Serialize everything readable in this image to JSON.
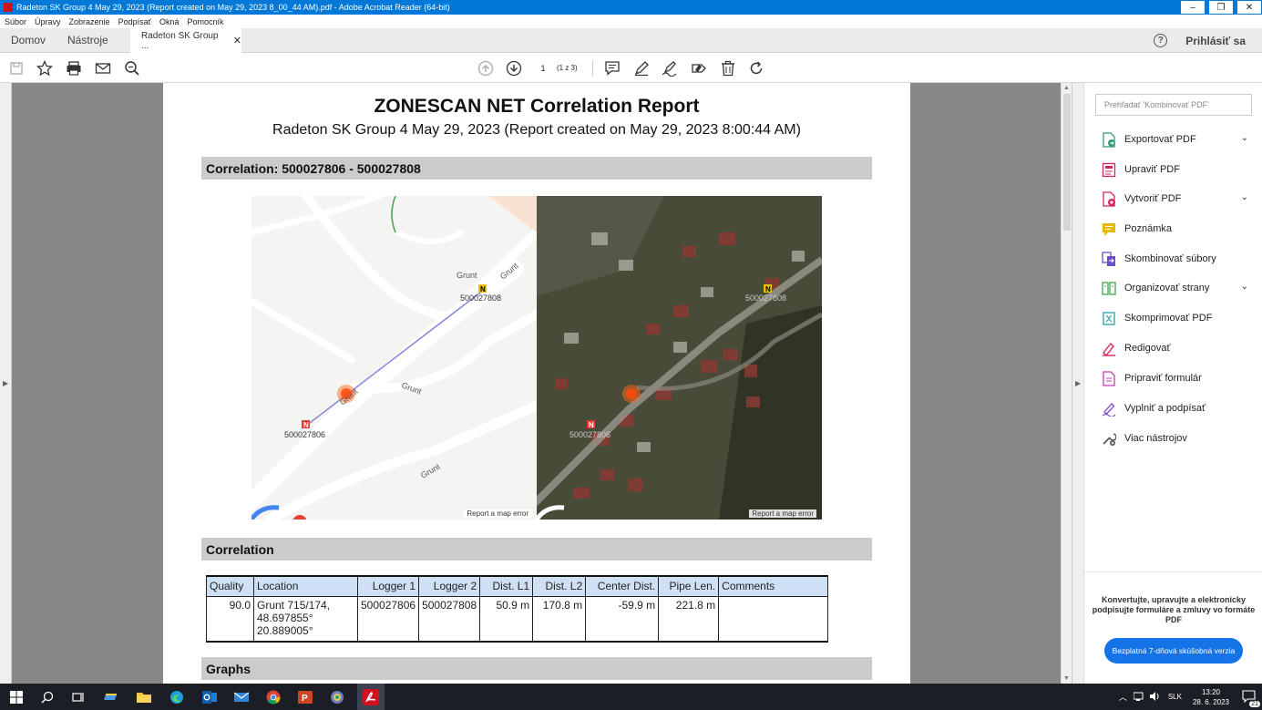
{
  "window": {
    "title": "Radeton SK Group 4 May 29, 2023 (Report created on May 29, 2023 8_00_44 AM).pdf - Adobe Acrobat Reader (64-bit)"
  },
  "menu": [
    "Súbor",
    "Úpravy",
    "Zobrazenie",
    "Podpísať",
    "Okná",
    "Pomocník"
  ],
  "tabs": {
    "home": "Domov",
    "tools": "Nástroje",
    "document": "Radeton SK Group ...",
    "signin": "Prihlásiť sa"
  },
  "toolbar": {
    "page_current": "1",
    "page_count": "(1 z 3)"
  },
  "report": {
    "title": "ZONESCAN NET Correlation Report",
    "subtitle": "Radeton SK Group 4 May 29, 2023 (Report created on May 29, 2023 8:00:44 AM)",
    "section_correlation_header": "Correlation: 500027806 - 500027808",
    "section_correlation": "Correlation",
    "section_graphs": "Graphs",
    "map": {
      "logger1": "500027806",
      "logger2": "500027808",
      "marker_1": "N",
      "marker_2": "N",
      "street_labels": [
        "Grunt",
        "Grunt",
        "Grunt",
        "Grunt",
        "Grunt"
      ],
      "credit": "Report a map error"
    },
    "table": {
      "headers": [
        "Quality",
        "Location",
        "Logger 1",
        "Logger 2",
        "Dist. L1",
        "Dist. L2",
        "Center Dist.",
        "Pipe Len.",
        "Comments"
      ],
      "row": {
        "quality": "90.0",
        "location_1": "Grunt 715/174,",
        "location_2": "48.697855°",
        "location_3": "20.889005°",
        "logger1": "500027806",
        "logger2": "500027808",
        "dist_l1": "50.9 m",
        "dist_l2": "170.8 m",
        "center_dist": "-59.9 m",
        "pipe_len": "221.8 m",
        "comments": ""
      }
    }
  },
  "panel": {
    "search_placeholder": "Prehľadať 'Kombinovať PDF'",
    "tools": [
      {
        "label": "Exportovať PDF",
        "color": "#2d9d78",
        "expand": true
      },
      {
        "label": "Upraviť PDF",
        "color": "#d92361",
        "expand": false
      },
      {
        "label": "Vytvoriť PDF",
        "color": "#d92361",
        "expand": true
      },
      {
        "label": "Poznámka",
        "color": "#e6b800",
        "expand": false
      },
      {
        "label": "Skombinovať súbory",
        "color": "#6b4fc7",
        "expand": false
      },
      {
        "label": "Organizovať strany",
        "color": "#3da74e",
        "expand": true
      },
      {
        "label": "Skomprimovať PDF",
        "color": "#2d9da8",
        "expand": false
      },
      {
        "label": "Redigovať",
        "color": "#d92361",
        "expand": false
      },
      {
        "label": "Pripraviť formulár",
        "color": "#c13fb5",
        "expand": false
      },
      {
        "label": "Vyplniť a podpísať",
        "color": "#7a4fc7",
        "expand": false
      },
      {
        "label": "Viac nástrojov",
        "color": "#555555",
        "expand": false
      }
    ],
    "promo": "Konvertujte, upravujte a elektronicky podpisujte formuláre a zmluvy vo formáte PDF",
    "trial_button": "Bezplatná 7-dňová skúšobná verzia"
  },
  "taskbar": {
    "lang": "SLK",
    "time": "13:20",
    "date": "28. 6. 2023",
    "notifications": "21"
  }
}
